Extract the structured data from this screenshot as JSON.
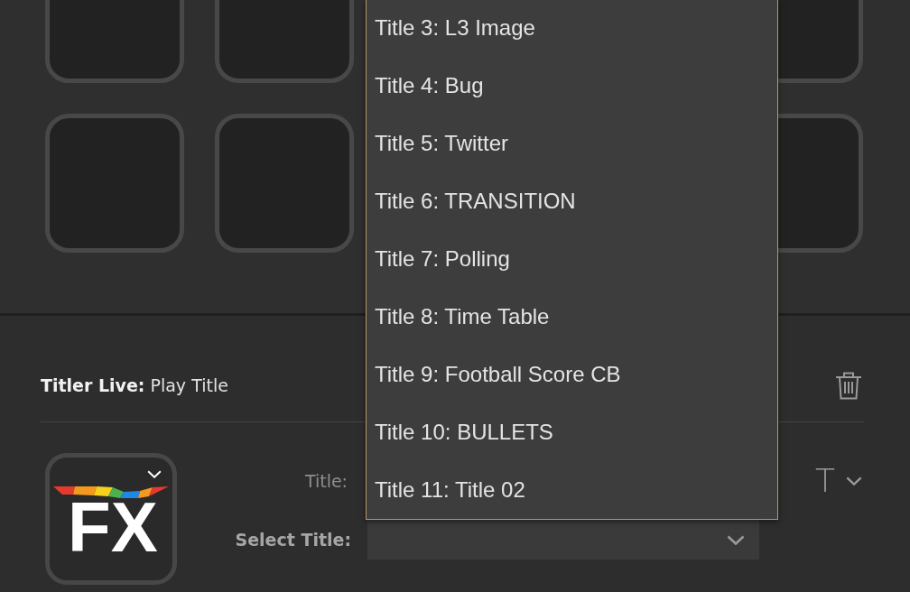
{
  "panel": {
    "heading": "**Titler Live:** Play Title",
    "logo": {
      "text": "FX"
    },
    "fields": [
      {
        "kind": "plain",
        "label": "Title:"
      },
      {
        "kind": "select",
        "label": "Select Title:",
        "expanded": true,
        "options": [
          {
            "label": "Title 3: L3 Image",
            "selected": false
          },
          {
            "label": "Title 4: Bug",
            "selected": false
          },
          {
            "label": "Title 5: Twitter",
            "selected": false
          },
          {
            "label": "Title 6: TRANSITION",
            "selected": false
          },
          {
            "label": "Title 7: Polling",
            "selected": false
          },
          {
            "label": "Title 8: Time Table",
            "selected": false
          },
          {
            "label": "Title 9: Football Score CB",
            "selected": false
          },
          {
            "label": "Title 10: BULLETS",
            "selected": false
          },
          {
            "label": "Title 11: Title 02",
            "selected": false
          }
        ]
      }
    ],
    "format_button": {
      "glyph": "T"
    }
  }
}
